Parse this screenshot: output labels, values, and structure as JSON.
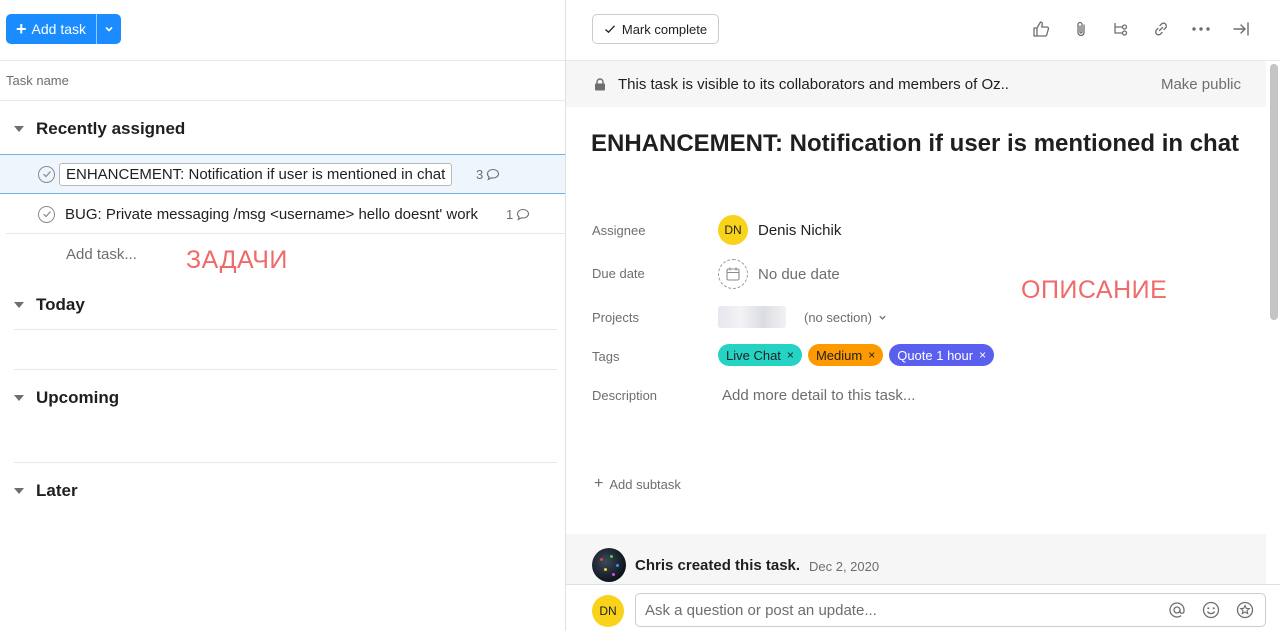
{
  "left": {
    "add_task_label": "Add task",
    "column_header": "Task name",
    "sections": {
      "recently_assigned": "Recently assigned",
      "today": "Today",
      "upcoming": "Upcoming",
      "later": "Later"
    },
    "tasks": [
      {
        "name": "ENHANCEMENT: Notification if user is mentioned in chat",
        "comments": "3"
      },
      {
        "name": "BUG: Private messaging /msg <username> hello doesnt' work",
        "comments": "1"
      }
    ],
    "add_task_placeholder": "Add task...",
    "annotation": "ЗАДАЧИ"
  },
  "right": {
    "mark_complete_label": "Mark complete",
    "toolbar_icons": [
      "like-icon",
      "attachment-icon",
      "subtask-icon",
      "link-icon",
      "more-icon",
      "close-pane-icon"
    ],
    "visibility_banner": "This task is visible to its collaborators and members of Oz..",
    "make_public_label": "Make public",
    "task_title": "ENHANCEMENT: Notification if user is mentioned in chat",
    "fields": {
      "assignee_label": "Assignee",
      "assignee_initials": "DN",
      "assignee_name": "Denis Nichik",
      "due_date_label": "Due date",
      "due_date_value": "No due date",
      "projects_label": "Projects",
      "project_section": "(no section)",
      "tags_label": "Tags",
      "tags": [
        {
          "label": "Live Chat",
          "color": "#25d3c4"
        },
        {
          "label": "Medium",
          "color": "#fd9a00"
        },
        {
          "label": "Quote 1 hour",
          "color": "#5b5fef"
        }
      ],
      "description_label": "Description",
      "description_placeholder": "Add more detail to this task..."
    },
    "add_subtask_label": "Add subtask",
    "annotation": "ОПИСАНИЕ",
    "activity": {
      "text": "Chris created this task.",
      "date": "Dec 2, 2020"
    },
    "composer": {
      "avatar_initials": "DN",
      "placeholder": "Ask a question or post an update..."
    }
  },
  "colors": {
    "primary_button": "#1a8cff",
    "annotation_red": "#f06a6a",
    "avatar_yellow": "#f8d31a"
  }
}
